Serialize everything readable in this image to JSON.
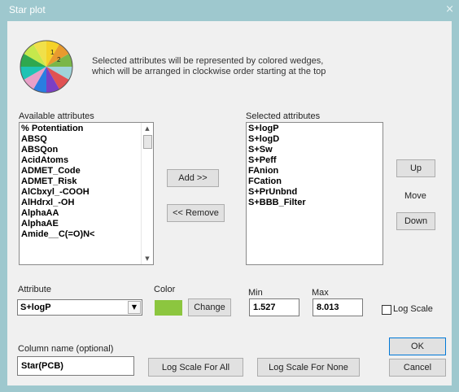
{
  "window": {
    "title": "Star plot",
    "close_glyph": "×"
  },
  "intro": {
    "icon": "star-plot-pie-icon",
    "wedge_labels": [
      "1",
      "2"
    ],
    "line1": "Selected attributes will be represented by colored wedges,",
    "line2": "which will be arranged in clockwise order starting at the top"
  },
  "available": {
    "label": "Available attributes",
    "items": [
      "% Potentiation",
      "ABSQ",
      "ABSQon",
      "AcidAtoms",
      "ADMET_Code",
      "ADMET_Risk",
      "AlCbxyl_-COOH",
      "AlHdrxl_-OH",
      "AlphaAA",
      "AlphaAE",
      "Amide__C(=O)N<"
    ]
  },
  "selected": {
    "label": "Selected attributes",
    "items": [
      "S+logP",
      "S+logD",
      "S+Sw",
      "S+Peff",
      "FAnion",
      "FCation",
      "S+PrUnbnd",
      "S+BBB_Filter"
    ]
  },
  "buttons": {
    "add": "Add >>",
    "remove": "<< Remove",
    "up": "Up",
    "move": "Move",
    "down": "Down",
    "change": "Change",
    "log_all": "Log Scale For All",
    "log_none": "Log Scale For None",
    "ok": "OK",
    "cancel": "Cancel"
  },
  "attribute": {
    "label": "Attribute",
    "value": "S+logP"
  },
  "color": {
    "label": "Color",
    "value": "#8cc63f"
  },
  "min": {
    "label": "Min",
    "value": "1.527"
  },
  "max": {
    "label": "Max",
    "value": "8.013"
  },
  "log_scale": {
    "label": "Log Scale",
    "checked": false
  },
  "column_name": {
    "label": "Column name (optional)",
    "value": "Star(PCB)"
  },
  "pie_colors": [
    "#f5d228",
    "#e89a2e",
    "#7ab648",
    "#9fd3d9",
    "#e05252",
    "#7b3fc4",
    "#2a7de1",
    "#e8a0c8",
    "#1fc3b4",
    "#2fa84f",
    "#c6e84c",
    "#f0e04a"
  ]
}
